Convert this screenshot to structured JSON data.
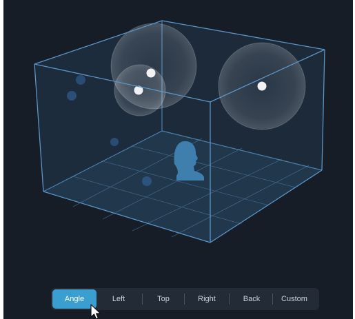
{
  "scene": {
    "room_color": "#4f8fc0",
    "floor_color": "#24405a",
    "wall_color": "#2e5170",
    "sphere_color": "#ffffff",
    "dot_color": "#2f5a8a",
    "head_color": "#3f7fad"
  },
  "toolbar": {
    "active": "Angle",
    "accent_color": "#3a9fd0",
    "views": [
      {
        "id": "angle",
        "label": "Angle"
      },
      {
        "id": "left",
        "label": "Left"
      },
      {
        "id": "top",
        "label": "Top"
      },
      {
        "id": "right",
        "label": "Right"
      },
      {
        "id": "back",
        "label": "Back"
      },
      {
        "id": "custom",
        "label": "Custom"
      }
    ]
  },
  "cursor": {
    "icon": "arrow-cursor-icon"
  }
}
